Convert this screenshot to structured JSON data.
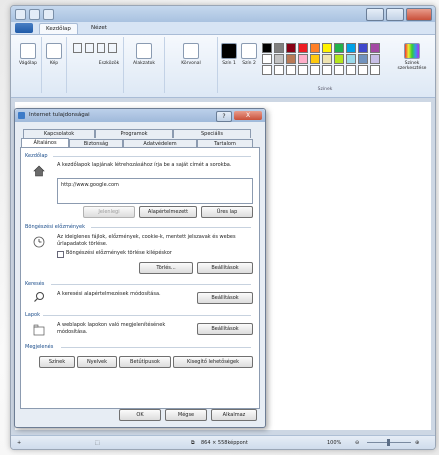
{
  "window": {
    "title": "",
    "tabs": [
      {
        "label": "Kezdőlap"
      },
      {
        "label": "Nézet"
      }
    ]
  },
  "ribbon": {
    "groups": [
      {
        "buttons": [
          {
            "label": "Vágólap"
          }
        ]
      },
      {
        "buttons": [
          {
            "label": "Kép"
          }
        ]
      },
      {
        "buttons": [
          {
            "label": "Eszközök"
          }
        ]
      },
      {
        "buttons": [
          {
            "label": "Alakzatok"
          }
        ]
      },
      {
        "buttons": [
          {
            "label": "Körvonal"
          }
        ]
      },
      {
        "buttons": [
          {
            "label": "Szín 1"
          },
          {
            "label": "Szín 2"
          },
          {
            "label": "Színek szerkesztése"
          }
        ],
        "group_label": "Színek"
      }
    ]
  },
  "status": {
    "dimensions": "864 × 558képpont",
    "zoom": "100%"
  },
  "dialog": {
    "title": "Internet tulajdonságai",
    "help_label": "?",
    "close_label": "X",
    "tabs_row1": [
      {
        "label": "Kapcsolatok"
      },
      {
        "label": "Programok"
      },
      {
        "label": "Speciális"
      }
    ],
    "tabs_row2": [
      {
        "label": "Általános"
      },
      {
        "label": "Biztonság"
      },
      {
        "label": "Adatvédelem"
      },
      {
        "label": "Tartalom"
      }
    ],
    "home": {
      "heading": "Kezdőlap",
      "description": "A kezdőlapok lapjának létrehozásához írja be a saját címét a sorokba.",
      "url": "http://www.google.com",
      "buttons": [
        "Jelenlegi",
        "Alapértelmezett",
        "Üres lap"
      ]
    },
    "history": {
      "heading": "Böngészési előzmények",
      "description": "Az ideiglenes fájlok, előzmények, cookie-k, mentett jelszavak és webes űrlapadatok törlése.",
      "checkbox_label": "Böngészési előzmények törlése kilépéskor",
      "buttons": [
        "Törlés...",
        "Beállítások"
      ]
    },
    "search": {
      "heading": "Keresés",
      "description": "A keresési alapértelmezések módosítása.",
      "button": "Beállítások"
    },
    "tabs_section": {
      "heading": "Lapok",
      "description": "A weblapok lapokon való megjelenítésének módosítása.",
      "button": "Beállítások"
    },
    "appearance": {
      "heading": "Megjelenés",
      "buttons": [
        "Színek",
        "Nyelvek",
        "Betűtípusok",
        "Kisegítő lehetőségek"
      ]
    },
    "footer": [
      "OK",
      "Mégse",
      "Alkalmaz"
    ]
  }
}
